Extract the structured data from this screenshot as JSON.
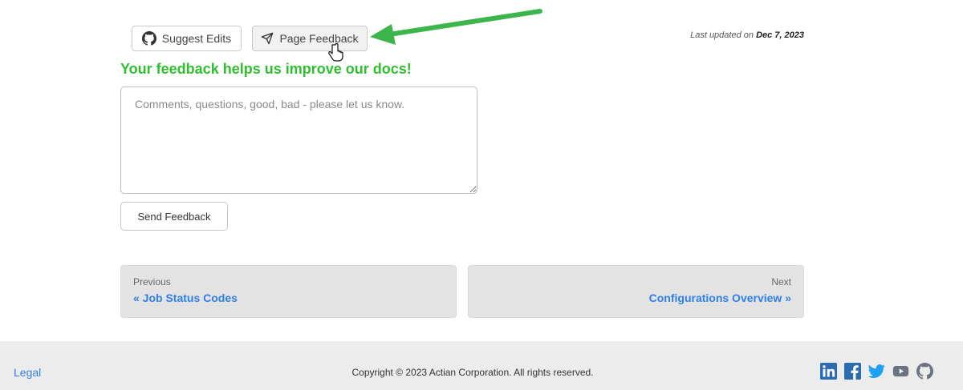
{
  "actions": {
    "suggest_edits_label": "Suggest Edits",
    "page_feedback_label": "Page Feedback",
    "last_updated_prefix": "Last updated on",
    "last_updated_date": "Dec 7, 2023"
  },
  "feedback": {
    "heading": "Your feedback helps us improve our docs!",
    "placeholder": "Comments, questions, good, bad - please let us know.",
    "send_label": "Send Feedback"
  },
  "pagination": {
    "previous_label": "Previous",
    "previous_title": "« Job Status Codes",
    "next_label": "Next",
    "next_title": "Configurations Overview »"
  },
  "footer": {
    "legal_label": "Legal",
    "copyright": "Copyright © 2023 Actian Corporation. All rights reserved.",
    "social_icons": [
      "linkedin-icon",
      "facebook-icon",
      "twitter-icon",
      "youtube-icon",
      "github-icon"
    ]
  },
  "colors": {
    "heading_green": "#2fbf2f",
    "link_blue": "#2f7fe8",
    "social_blue": "#2b6cb0",
    "annotation_arrow": "#3cb54a"
  }
}
